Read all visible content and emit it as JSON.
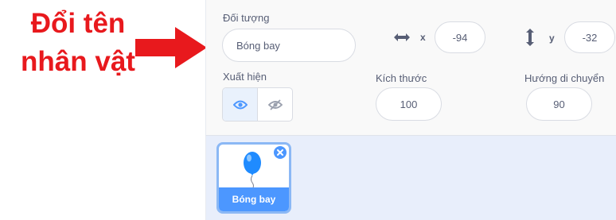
{
  "annotation": {
    "line1": "Đổi tên",
    "line2": "nhân vật"
  },
  "sprite_info": {
    "object_label": "Đối tượng",
    "name_value": "Bóng bay",
    "x_label": "x",
    "x_value": "-94",
    "y_label": "y",
    "y_value": "-32",
    "show_label": "Xuất hiện",
    "size_label": "Kích thước",
    "size_value": "100",
    "direction_label": "Hướng di chuyển",
    "direction_value": "90"
  },
  "sprite_list": {
    "items": [
      {
        "name": "Bóng bay",
        "selected": true
      }
    ]
  },
  "colors": {
    "annotation_red": "#e8191d",
    "accent_blue": "#4c97ff",
    "panel_text": "#575e75",
    "sprite_area_bg": "#e8eefb"
  },
  "icons": [
    "right-arrow",
    "horizontal-arrows",
    "vertical-arrows",
    "eye",
    "eye-slash",
    "balloon",
    "close"
  ]
}
